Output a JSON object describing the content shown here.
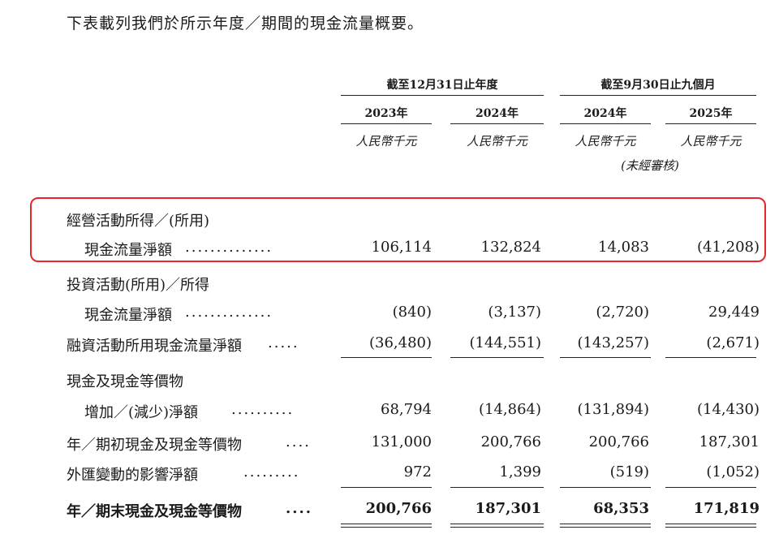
{
  "intro": "下表載列我們於所示年度／期間的現金流量概要。",
  "header": {
    "groups": [
      "截至12月31日止年度",
      "截至9月30日止九個月"
    ],
    "years": [
      "2023年",
      "2024年",
      "2024年",
      "2025年"
    ],
    "units": [
      "人民幣千元",
      "人民幣千元",
      "人民幣千元",
      "人民幣千元"
    ],
    "unaudited": "(未經審核)"
  },
  "rows": [
    {
      "label1": "經營活動所得／(所用)",
      "label2": "現金流量淨額",
      "dots": "..............",
      "values": [
        "106,114",
        "132,824",
        "14,083",
        "(41,208)"
      ]
    },
    {
      "label1": "投資活動(所用)／所得",
      "label2": "現金流量淨額",
      "dots": "..............",
      "values": [
        "(840)",
        "(3,137)",
        "(2,720)",
        "29,449"
      ]
    },
    {
      "label1": "融資活動所用現金流量淨額",
      "dots": ".....",
      "values": [
        "(36,480)",
        "(144,551)",
        "(143,257)",
        "(2,671)"
      ]
    },
    {
      "label1": "現金及現金等價物",
      "label2": "增加／(減少)淨額",
      "dots": "..........",
      "values": [
        "68,794",
        "(14,864)",
        "(131,894)",
        "(14,430)"
      ]
    },
    {
      "label1": "年／期初現金及現金等價物",
      "dots": "....",
      "values": [
        "131,000",
        "200,766",
        "200,766",
        "187,301"
      ]
    },
    {
      "label1": "外匯變動的影響淨額",
      "dots": ".........",
      "values": [
        "972",
        "1,399",
        "(519)",
        "(1,052)"
      ]
    },
    {
      "label1": "年／期末現金及現金等價物",
      "dots": "....",
      "values": [
        "200,766",
        "187,301",
        "68,353",
        "171,819"
      ]
    }
  ],
  "colors": {
    "highlight": "#e8262a"
  }
}
